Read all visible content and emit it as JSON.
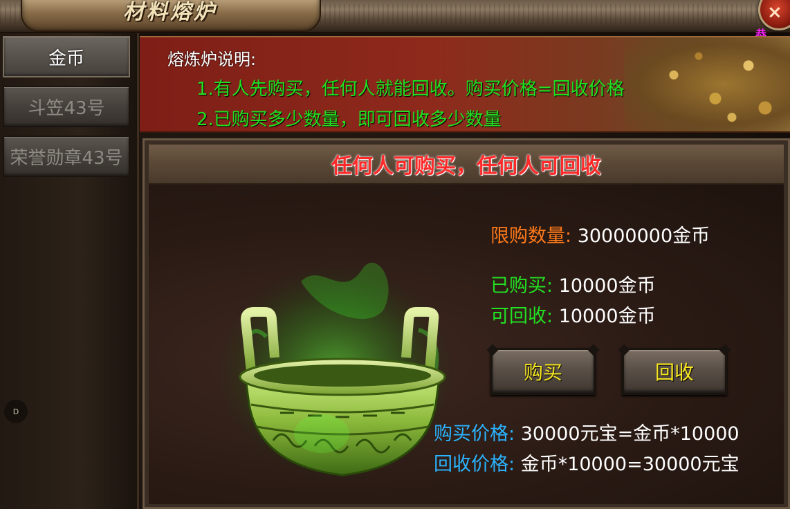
{
  "window": {
    "title": "材料熔炉",
    "close_label": "×",
    "corner_char": "恭"
  },
  "sidebar": {
    "items": [
      {
        "label": "金币",
        "active": true
      },
      {
        "label": "斗笠43号",
        "active": false
      },
      {
        "label": "荣誉勋章43号",
        "active": false
      }
    ],
    "dot_label": "D"
  },
  "description": {
    "title": "熔炼炉说明:",
    "lines": [
      "1.有人先购买，任何人就能回收。购买价格=回收价格",
      "2.已购买多少数量，即可回收多少数量"
    ]
  },
  "panel": {
    "header": "任何人可购买，任何人可回收",
    "limit": {
      "label": "限购数量:",
      "value": "30000000金币"
    },
    "bought": {
      "label": "已购买:",
      "value": "10000金币"
    },
    "recyclable": {
      "label": "可回收:",
      "value": "10000金币"
    },
    "buy_button": "购买",
    "recycle_button": "回收",
    "buy_price": {
      "label": "购买价格:",
      "value": "30000元宝=金币*10000"
    },
    "recycle_price": {
      "label": "回收价格:",
      "value": "金币*10000=30000元宝"
    }
  },
  "colors": {
    "label_orange": "#ff7a1a",
    "label_green": "#22e022",
    "label_cyan": "#2ab4ff",
    "button_text": "#f5e620",
    "header_red": "#ff2a2a"
  }
}
